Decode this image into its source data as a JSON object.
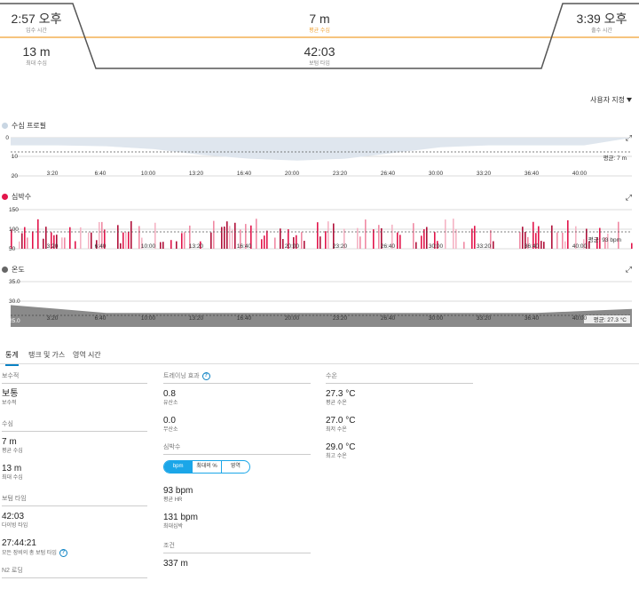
{
  "summary": {
    "entry_time": {
      "value": "2:57 오후",
      "label": "입수 시간"
    },
    "avg_depth": {
      "value": "7 m",
      "label": "평균 수심"
    },
    "exit_time": {
      "value": "3:39 오후",
      "label": "출수 시간"
    },
    "max_depth": {
      "value": "13 m",
      "label": "최대 수심"
    },
    "bottom_time": {
      "value": "42:03",
      "label": "보텀 타임"
    }
  },
  "customize_label": "사용자 지정",
  "charts": {
    "x_ticks": [
      "3:20",
      "6:40",
      "10:00",
      "13:20",
      "16:40",
      "20:00",
      "23:20",
      "26:40",
      "30:00",
      "33:20",
      "36:40",
      "40:00"
    ],
    "depth": {
      "title": "수심 프로필",
      "y_ticks": [
        "0",
        "10",
        "20"
      ],
      "avg_label": "평균: 7 m",
      "color": "#dfe6ee",
      "dot_color": "#c9d6e3"
    },
    "heart": {
      "title": "심박수",
      "y_ticks": [
        "150",
        "100",
        "50"
      ],
      "avg_label": "평균: 93 bpm",
      "dot_color": "#e2154b"
    },
    "temp": {
      "title": "온도",
      "y_ticks": [
        "35.0",
        "30.0",
        "25.0"
      ],
      "avg_label": "평균: 27.3 °C",
      "dot_color": "#666666"
    }
  },
  "chart_data": [
    {
      "type": "area",
      "title": "수심 프로필",
      "x": [
        "0:00",
        "3:20",
        "6:40",
        "10:00",
        "13:20",
        "16:40",
        "20:00",
        "23:20",
        "26:40",
        "30:00",
        "33:20",
        "36:40",
        "40:00",
        "42:03"
      ],
      "values": [
        4,
        4,
        4.5,
        6,
        9,
        11,
        12,
        11,
        8,
        5,
        4,
        4,
        4,
        0
      ],
      "ylabel": "",
      "ylim": [
        20,
        0
      ],
      "inverted_y": true,
      "average": 7
    },
    {
      "type": "bar",
      "title": "심박수",
      "ylim": [
        50,
        150
      ],
      "average": 93
    },
    {
      "type": "area",
      "title": "온도",
      "x": [
        "0:00",
        "3:20",
        "6:40",
        "10:00",
        "13:20",
        "16:40",
        "20:00",
        "23:20",
        "26:40",
        "30:00",
        "33:20",
        "36:40",
        "40:00",
        "42:03"
      ],
      "values": [
        29,
        28,
        27,
        27,
        27,
        27,
        27,
        27,
        27,
        27,
        27,
        27,
        27.5,
        28
      ],
      "ylim": [
        25,
        35
      ],
      "average": 27.3
    }
  ],
  "tabs": [
    "통계",
    "탱크 및 가스",
    "영역 시간"
  ],
  "stats": {
    "conservatism": {
      "heading": "보수적",
      "value": "보통",
      "label": "보수적"
    },
    "depth": {
      "heading": "수심",
      "avg": {
        "value": "7 m",
        "label": "평균 수심"
      },
      "max": {
        "value": "13 m",
        "label": "최대 수심"
      }
    },
    "bottom_time": {
      "heading": "보텀 타임",
      "dive": {
        "value": "42:03",
        "label": "다이빙 타임"
      },
      "total": {
        "value": "27:44:21",
        "label": "모든 장비의 총 보텀 타임"
      }
    },
    "n2_heading": "N2 로딩",
    "training_effect": {
      "heading": "트레이닝 효과",
      "aerobic": {
        "value": "0.8",
        "label": "유산소"
      },
      "anaerobic": {
        "value": "0.0",
        "label": "무산소"
      }
    },
    "heart_rate": {
      "heading": "심박수",
      "seg": [
        "bpm",
        "최대의 %",
        "영역"
      ],
      "avg": {
        "value": "93 bpm",
        "label": "평균 HR"
      },
      "max": {
        "value": "131 bpm",
        "label": "최대심박"
      }
    },
    "distance": {
      "heading": "조건",
      "value": "337 m"
    },
    "water_temp": {
      "heading": "수온",
      "avg": {
        "value": "27.3 °C",
        "label": "평균 수온"
      },
      "min": {
        "value": "27.0 °C",
        "label": "최저 수온"
      },
      "max": {
        "value": "29.0 °C",
        "label": "최고 수온"
      }
    }
  }
}
